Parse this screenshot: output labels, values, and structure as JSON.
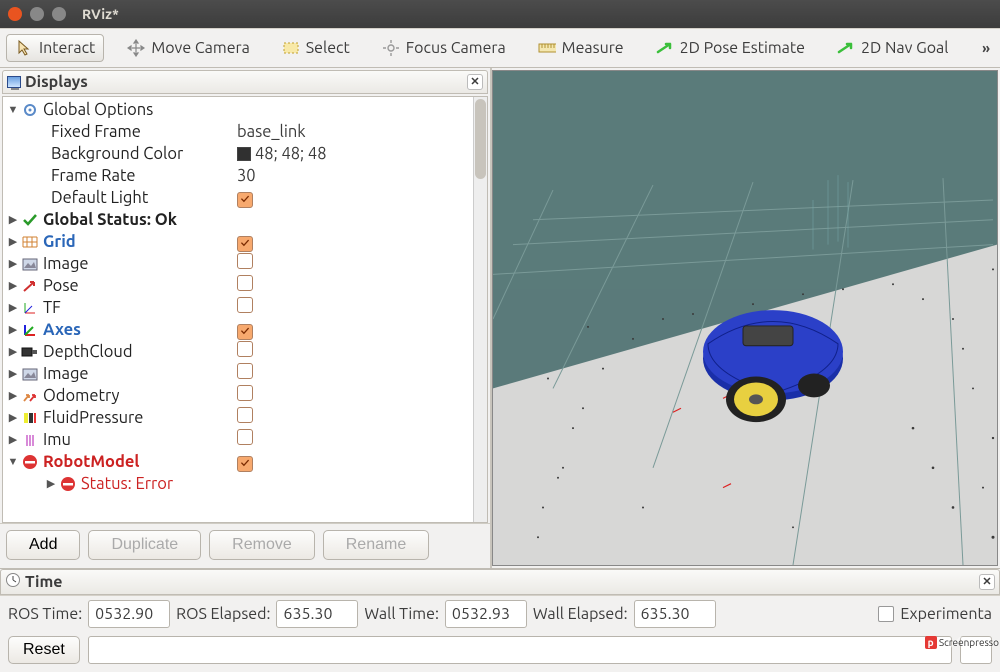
{
  "window": {
    "title": "RViz*"
  },
  "toolbar": {
    "items": [
      {
        "label": "Interact",
        "icon": "pointer-icon",
        "active": true
      },
      {
        "label": "Move Camera",
        "icon": "move-icon",
        "active": false
      },
      {
        "label": "Select",
        "icon": "select-icon",
        "active": false
      },
      {
        "label": "Focus Camera",
        "icon": "focus-icon",
        "active": false
      },
      {
        "label": "Measure",
        "icon": "ruler-icon",
        "active": false
      },
      {
        "label": "2D Pose Estimate",
        "icon": "arrow-green-icon",
        "active": false
      },
      {
        "label": "2D Nav Goal",
        "icon": "arrow-green-icon",
        "active": false
      }
    ],
    "overflow": "»"
  },
  "displays_panel": {
    "title": "Displays",
    "global_options": {
      "label": "Global Options",
      "fixed_frame_label": "Fixed Frame",
      "fixed_frame_value": "base_link",
      "bg_color_label": "Background Color",
      "bg_color_value": "48; 48; 48",
      "frame_rate_label": "Frame Rate",
      "frame_rate_value": "30",
      "default_light_label": "Default Light",
      "default_light_checked": true
    },
    "global_status": {
      "label": "Global Status: Ok"
    },
    "items": [
      {
        "name": "Grid",
        "icon": "grid-icon",
        "blue": true,
        "checked": true
      },
      {
        "name": "Image",
        "icon": "image-icon",
        "blue": false,
        "checked": false
      },
      {
        "name": "Pose",
        "icon": "pose-icon",
        "blue": false,
        "checked": false
      },
      {
        "name": "TF",
        "icon": "tf-icon",
        "blue": false,
        "checked": false
      },
      {
        "name": "Axes",
        "icon": "axes-icon",
        "blue": true,
        "checked": true
      },
      {
        "name": "DepthCloud",
        "icon": "depth-icon",
        "blue": false,
        "checked": false
      },
      {
        "name": "Image",
        "icon": "image-icon",
        "blue": false,
        "checked": false
      },
      {
        "name": "Odometry",
        "icon": "odom-icon",
        "blue": false,
        "checked": false
      },
      {
        "name": "FluidPressure",
        "icon": "pressure-icon",
        "blue": false,
        "checked": false
      },
      {
        "name": "Imu",
        "icon": "imu-icon",
        "blue": false,
        "checked": false
      }
    ],
    "robot_model": {
      "label": "RobotModel",
      "status_label": "Status: Error",
      "checked": true
    },
    "buttons": {
      "add": "Add",
      "duplicate": "Duplicate",
      "remove": "Remove",
      "rename": "Rename"
    }
  },
  "time_panel": {
    "title": "Time",
    "ros_time_label": "ROS Time:",
    "ros_time_value": "0532.90",
    "ros_elapsed_label": "ROS Elapsed:",
    "ros_elapsed_value": "635.30",
    "wall_time_label": "Wall Time:",
    "wall_time_value": "0532.93",
    "wall_elapsed_label": "Wall Elapsed:",
    "wall_elapsed_value": "635.30",
    "experimental_label": "Experimenta",
    "reset_label": "Reset"
  },
  "watermark": "Screenpresso"
}
